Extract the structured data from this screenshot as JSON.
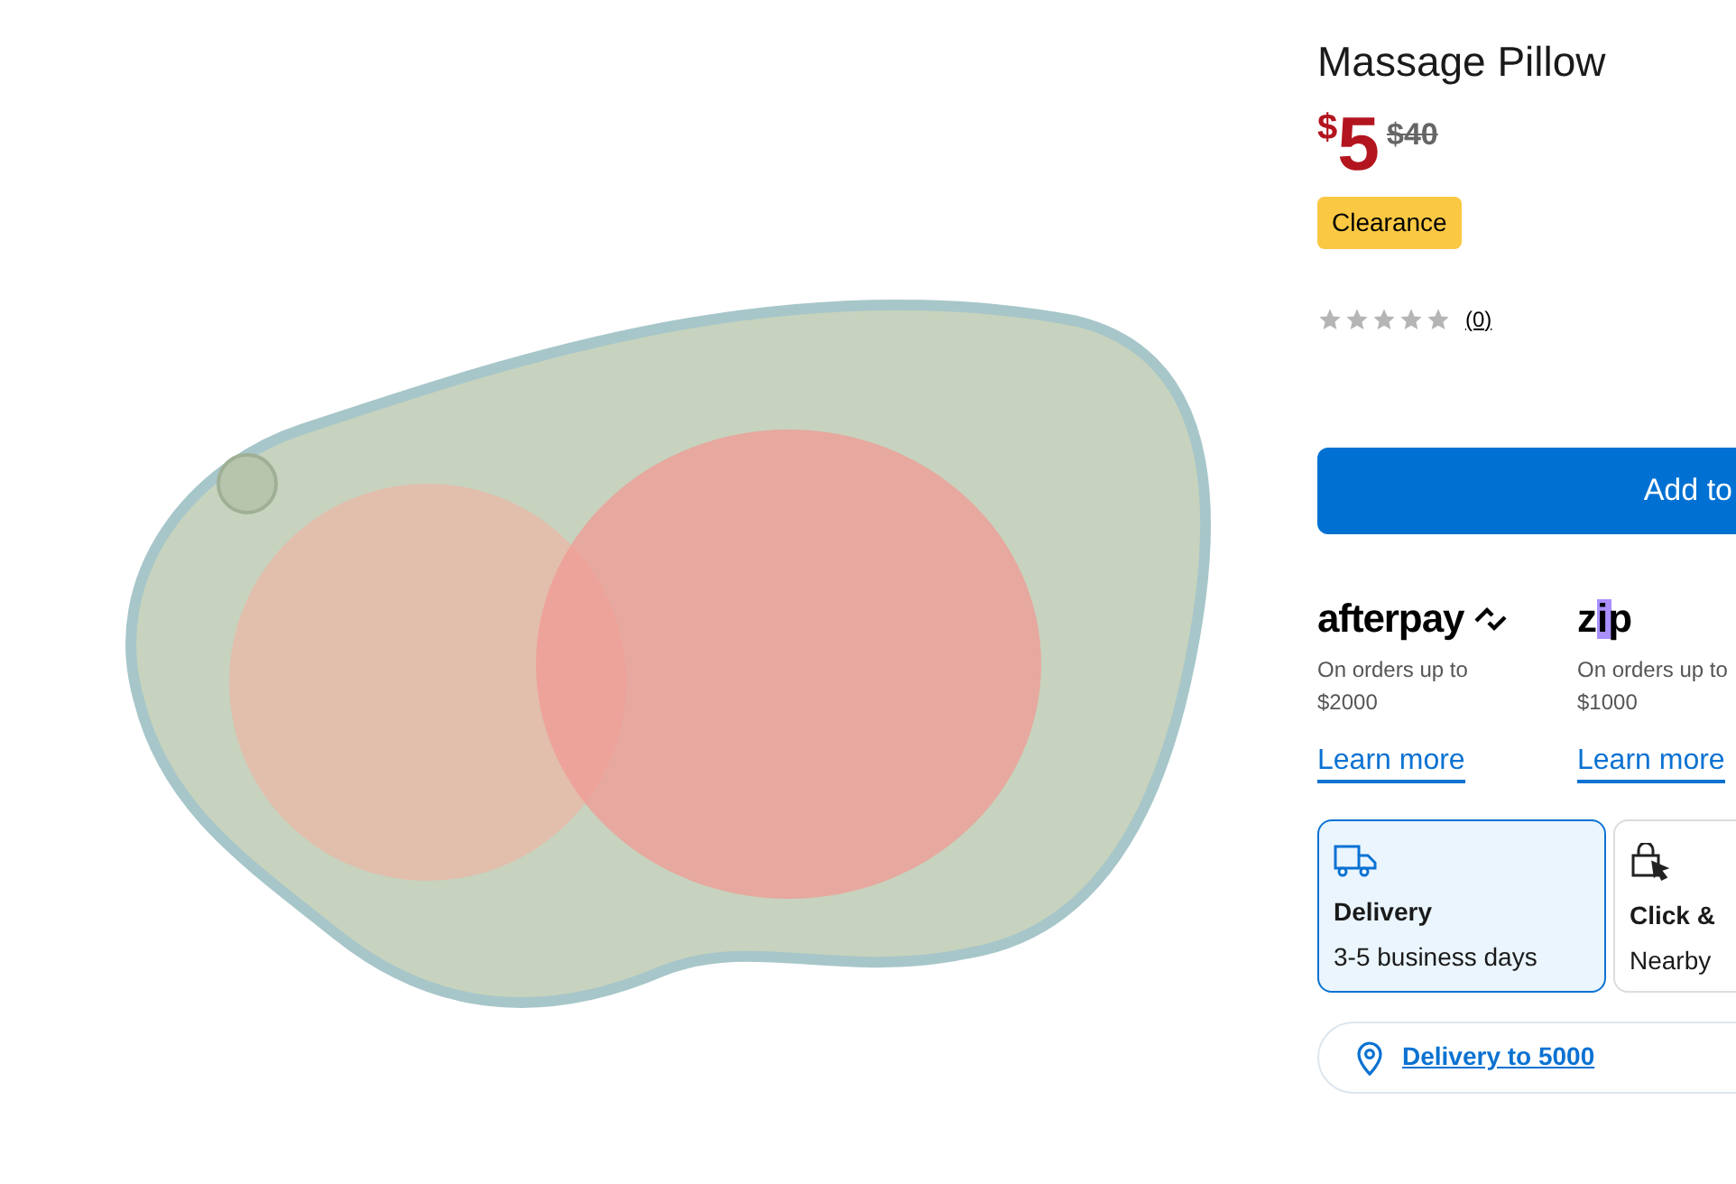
{
  "product": {
    "title": "Massage Pillow",
    "currency": "$",
    "price": "5",
    "was_price": "$40",
    "badge": "Clearance",
    "stars": 0,
    "review_count": "(0)"
  },
  "add_button": "Add to",
  "payments": [
    {
      "kind": "afterpay",
      "logo": "afterpay",
      "line1": "On orders up to",
      "line2": "$2000",
      "link": "Learn more"
    },
    {
      "kind": "zip",
      "logo": "zip",
      "line1": "On orders up to",
      "line2": "$1000",
      "link": "Learn more"
    }
  ],
  "fulfilment": [
    {
      "kind": "delivery",
      "title": "Delivery",
      "subtitle": "3-5 business days",
      "selected": true
    },
    {
      "kind": "pickup",
      "title": "Click &",
      "subtitle": "Nearby",
      "selected": false
    }
  ],
  "location_link": "Delivery to 5000"
}
